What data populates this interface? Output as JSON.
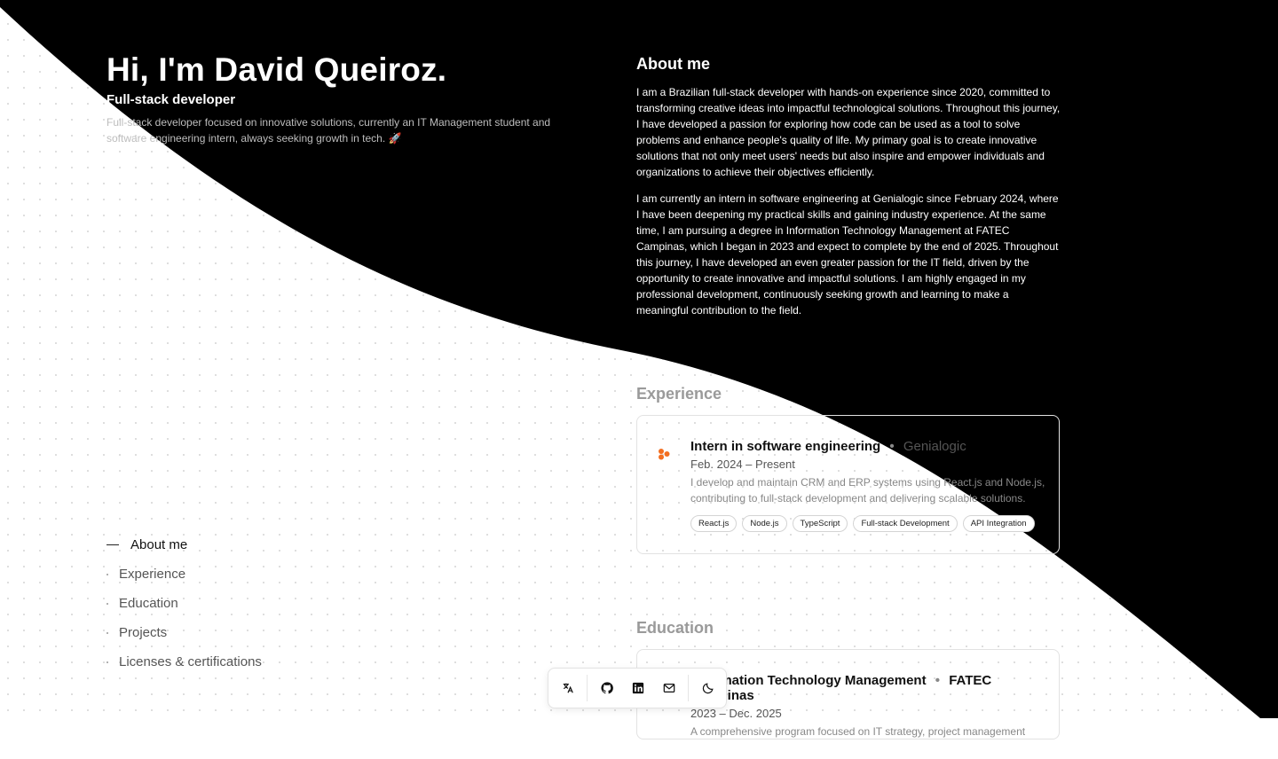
{
  "hero": {
    "title": "Hi, I'm David Queiroz.",
    "role": "Full-stack developer",
    "bio": "Full-stack developer focused on innovative solutions, currently an IT Management student and software engineering intern, always seeking growth in tech. 🚀"
  },
  "nav": {
    "items": [
      {
        "label": "About me",
        "active": true
      },
      {
        "label": "Experience"
      },
      {
        "label": "Education"
      },
      {
        "label": "Projects"
      },
      {
        "label": "Licenses & certifications"
      }
    ]
  },
  "about": {
    "heading": "About me",
    "paragraphs": [
      "I am a Brazilian full-stack developer with hands-on experience since 2020, committed to transforming creative ideas into impactful technological solutions. Throughout this journey, I have developed a passion for exploring how code can be used as a tool to solve problems and enhance people's quality of life. My primary goal is to create innovative solutions that not only meet users' needs but also inspire and empower individuals and organizations to achieve their objectives efficiently.",
      "I am currently an intern in software engineering at Genialogic since February 2024, where I have been deepening my practical skills and gaining industry experience. At the same time, I am pursuing a degree in Information Technology Management at FATEC Campinas, which I began in 2023 and expect to complete by the end of 2025. Throughout this journey, I have developed an even greater passion for the IT field, driven by the opportunity to create innovative and impactful solutions. I am highly engaged in my professional development, continuously seeking growth and learning to make a meaningful contribution to the field."
    ]
  },
  "experience": {
    "heading": "Experience",
    "title": "Intern in software engineering",
    "separator": "•",
    "company": "Genialogic",
    "date_start": "Feb. 2024",
    "date_sep": "–",
    "date_end": "Present",
    "description": "I develop and maintain CRM and ERP systems using React.js and Node.js, contributing to full-stack development and delivering scalable solutions.",
    "tags": [
      "React.js",
      "Node.js",
      "TypeScript",
      "Full-stack Development",
      "API Integration"
    ],
    "logo_color": "#f36f21"
  },
  "education": {
    "heading": "Education",
    "title": "Information Technology Management",
    "separator": "•",
    "company": "FATEC Campinas",
    "date_start": "2023",
    "date_sep": "–",
    "date_end": "Dec. 2025",
    "description": "A comprehensive program focused on IT strategy, project management"
  },
  "toolbar": {
    "icons": [
      "translate-icon",
      "github-icon",
      "linkedin-icon",
      "mail-icon",
      "moon-icon"
    ]
  },
  "colors": {
    "dark": "#000000",
    "light": "#ffffff",
    "accent": "#f36f21"
  }
}
